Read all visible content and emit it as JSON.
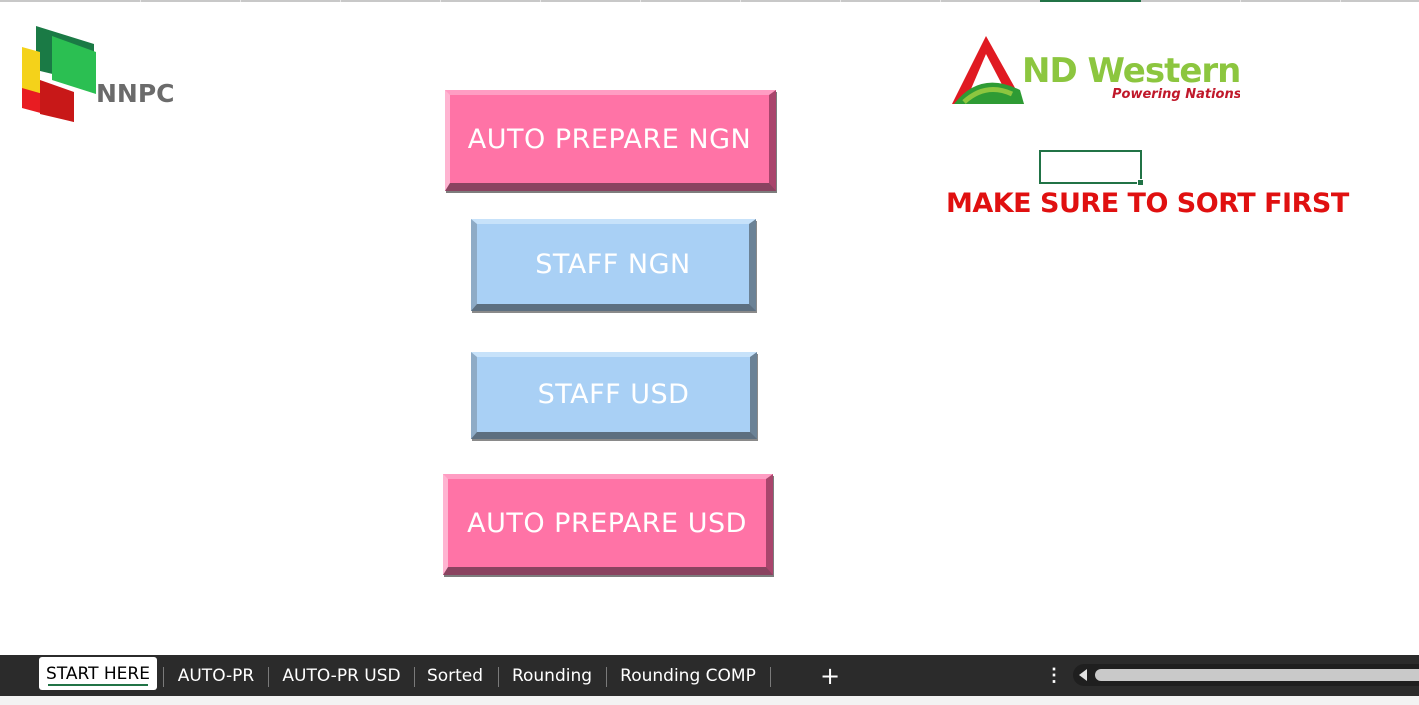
{
  "logos": {
    "left_text": "NNPC",
    "right_main_text": "ND Western",
    "right_tagline": "Powering Nations"
  },
  "buttons": {
    "auto_prepare_ngn": "AUTO PREPARE NGN",
    "staff_ngn": "STAFF NGN",
    "staff_usd": "STAFF USD",
    "auto_prepare_usd": "AUTO PREPARE USD"
  },
  "warning_text": "MAKE SURE TO SORT FIRST",
  "sheet_tabs": [
    {
      "label": "START HERE",
      "active": true
    },
    {
      "label": "AUTO-PR",
      "active": false
    },
    {
      "label": "AUTO-PR USD",
      "active": false
    },
    {
      "label": "Sorted",
      "active": false
    },
    {
      "label": "Rounding",
      "active": false
    },
    {
      "label": "Rounding COMP",
      "active": false
    }
  ],
  "tabbar": {
    "add_sheet_icon": "plus-icon",
    "more_icon": "vertical-ellipsis-icon"
  },
  "colors": {
    "pink_button": "#ff73a6",
    "blue_button": "#a9d0f5",
    "warning": "#e01010",
    "excel_green": "#217346",
    "tabbar_bg": "#2b2b2b"
  }
}
